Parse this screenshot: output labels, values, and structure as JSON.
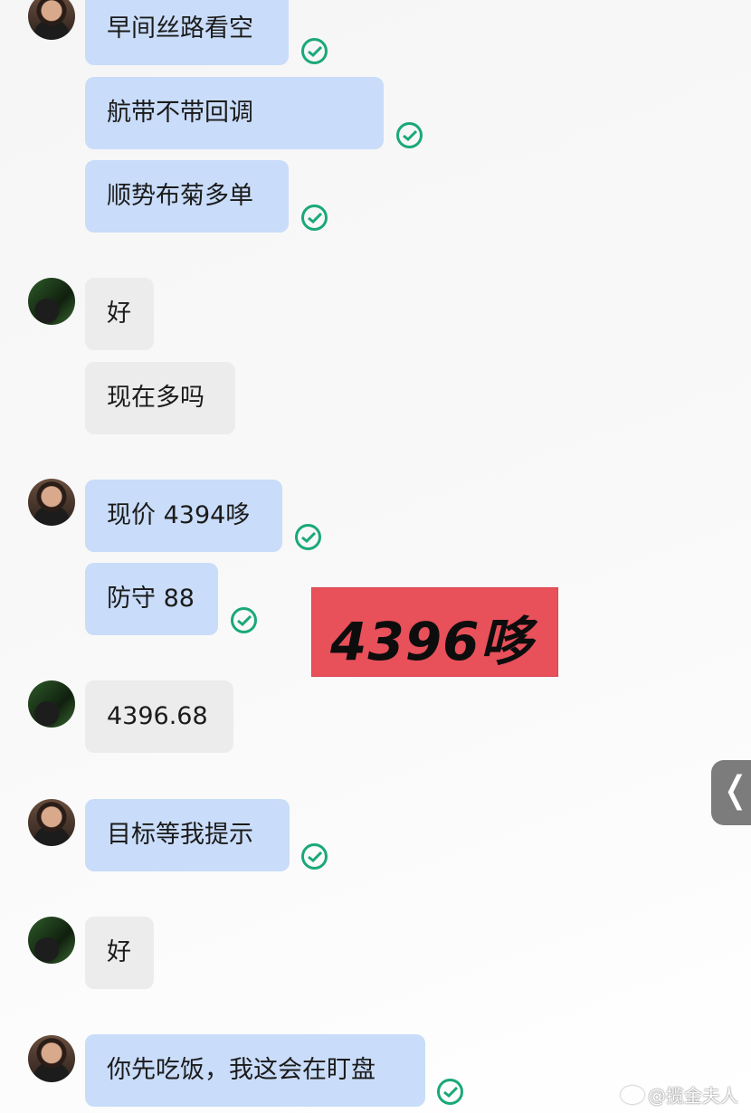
{
  "messages": [
    {
      "text": "早间丝路看空",
      "sender": "self"
    },
    {
      "text": "航带不带回调",
      "sender": "self"
    },
    {
      "text": "顺势布菊多单",
      "sender": "self"
    },
    {
      "text": "好",
      "sender": "other"
    },
    {
      "text": "现在多吗",
      "sender": "other"
    },
    {
      "text": "现价 4394哆",
      "sender": "self"
    },
    {
      "text": "防守 88",
      "sender": "self"
    },
    {
      "text": "4396.68",
      "sender": "other"
    },
    {
      "text": "目标等我提示",
      "sender": "self"
    },
    {
      "text": "好",
      "sender": "other"
    },
    {
      "text": "你先吃饭，我这会在盯盘",
      "sender": "self"
    }
  ],
  "badge": {
    "text": "4396哆",
    "color": "#e8505a"
  },
  "side_tab": {
    "glyph": "❬",
    "icon": "collapse-chevron-icon"
  },
  "watermark": {
    "text": "@揽金夫人",
    "icon": "weibo-icon"
  },
  "colors": {
    "self_bubble": "#c9dcf9",
    "other_bubble": "#ececec",
    "check": "#1aa87a"
  }
}
